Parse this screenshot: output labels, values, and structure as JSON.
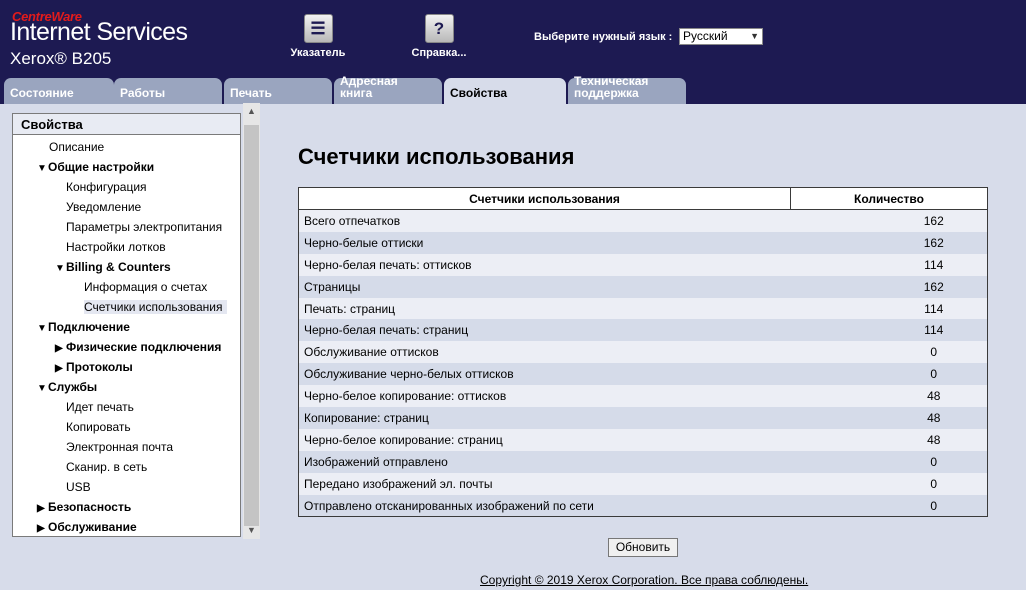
{
  "header": {
    "brand_small": "CentreWare",
    "brand_big": "Internet Services",
    "model": "Xerox® B205",
    "index_button": "Указатель",
    "help_button": "Справка...",
    "language_label": "Выберите нужный язык :",
    "language_value": "Русский"
  },
  "tabs": [
    {
      "label": "Состояние"
    },
    {
      "label": "Работы"
    },
    {
      "label": "Печать"
    },
    {
      "label": "Адресная книга"
    },
    {
      "label": "Свойства",
      "active": true
    },
    {
      "label": "Техническая поддержка"
    }
  ],
  "sidebar": {
    "title": "Свойства",
    "items": [
      {
        "label": "Описание"
      },
      {
        "label": "Общие настройки",
        "bold": true,
        "expanded": true
      },
      {
        "label": "Конфигурация"
      },
      {
        "label": "Уведомление"
      },
      {
        "label": "Параметры электропитания"
      },
      {
        "label": "Настройки лотков"
      },
      {
        "label": "Billing & Counters",
        "bold": true,
        "expanded": true
      },
      {
        "label": "Информация о счетах"
      },
      {
        "label": "Счетчики использования",
        "selected": true
      },
      {
        "label": "Подключение",
        "bold": true,
        "expanded": true
      },
      {
        "label": "Физические подключения",
        "bold": true,
        "expanded": false
      },
      {
        "label": "Протоколы",
        "bold": true,
        "expanded": false
      },
      {
        "label": "Службы",
        "bold": true,
        "expanded": true
      },
      {
        "label": "Идет печать"
      },
      {
        "label": "Копировать"
      },
      {
        "label": "Электронная почта"
      },
      {
        "label": "Сканир. в сеть"
      },
      {
        "label": "USB"
      },
      {
        "label": "Безопасность",
        "bold": true,
        "expanded": false
      },
      {
        "label": "Обслуживание",
        "bold": true,
        "expanded": false
      }
    ]
  },
  "main": {
    "title": "Счетчики использования",
    "table": {
      "headers": [
        "Счетчики использования",
        "Количество"
      ],
      "rows": [
        [
          "Всего отпечатков",
          "162"
        ],
        [
          "Черно-белые оттиски",
          "162"
        ],
        [
          "Черно-белая печать: оттисков",
          "114"
        ],
        [
          "Страницы",
          "162"
        ],
        [
          "Печать: страниц",
          "114"
        ],
        [
          "Черно-белая печать: страниц",
          "114"
        ],
        [
          "Обслуживание оттисков",
          "0"
        ],
        [
          "Обслуживание черно-белых оттисков",
          "0"
        ],
        [
          "Черно-белое копирование: оттисков",
          "48"
        ],
        [
          "Копирование: страниц",
          "48"
        ],
        [
          "Черно-белое копирование: страниц",
          "48"
        ],
        [
          "Изображений отправлено",
          "0"
        ],
        [
          "Передано изображений эл. почты",
          "0"
        ],
        [
          "Отправлено отсканированных изображений по сети",
          "0"
        ]
      ]
    },
    "refresh_button": "Обновить",
    "copyright": "Copyright © 2019 Xerox Corporation. Все права соблюдены."
  }
}
